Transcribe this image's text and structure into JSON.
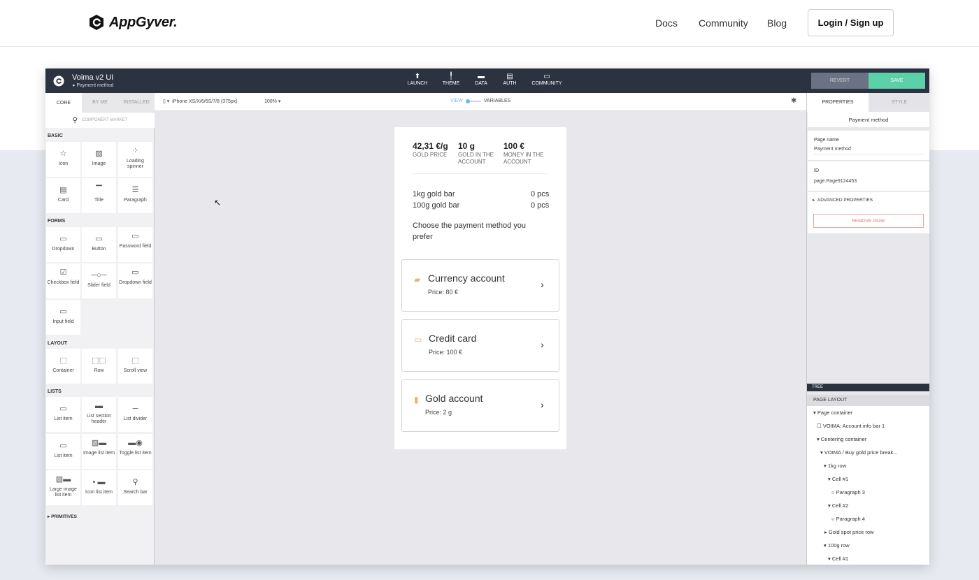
{
  "site": {
    "brand": "AppGyver.",
    "nav": [
      "Docs",
      "Community",
      "Blog"
    ],
    "login": "Login / Sign up"
  },
  "app": {
    "project_name": "Voima v2 UI",
    "page_name": "Payment method",
    "topnav": [
      {
        "label": "LAUNCH",
        "icon": "rocket-icon"
      },
      {
        "label": "THEME",
        "icon": "brush-icon"
      },
      {
        "label": "DATA",
        "icon": "folder-icon"
      },
      {
        "label": "AUTH",
        "icon": "document-icon"
      },
      {
        "label": "COMMUNITY",
        "icon": "chat-icon"
      }
    ],
    "revert": "REVERT",
    "save": "SAVE",
    "save_color": "#5cd0a8"
  },
  "left": {
    "tabs": [
      "CORE",
      "BY ME",
      "INSTALLED"
    ],
    "search_placeholder": "COMPONENT MARKET",
    "sections": {
      "basic": "BASIC",
      "forms": "FORMS",
      "layout": "LAYOUT",
      "lists": "LISTS",
      "primitives": "PRIMITIVES"
    },
    "components": {
      "icon": "Icon",
      "image": "Image",
      "spinner": "Loading spinner",
      "card": "Card",
      "title": "Title",
      "paragraph": "Paragraph",
      "dropdown": "Dropdown",
      "button": "Button",
      "password": "Password field",
      "checkbox": "Checkbox field",
      "slider": "Slider field",
      "dropdown_field": "Dropdown field",
      "input": "Input field",
      "container": "Container",
      "row": "Row",
      "scroll": "Scroll view",
      "list_item": "List item",
      "list_section": "List section header",
      "list_divider": "List divider",
      "list_item2": "List item",
      "image_list": "Image list item",
      "toggle_list": "Toggle list item",
      "large_image_list": "Large image list item",
      "icon_list": "Icon list item",
      "search_bar": "Search bar"
    }
  },
  "canvas": {
    "device": "iPhone XS/X/6/6S/7/8 (375px)",
    "zoom": "100%",
    "view": "VIEW",
    "variables": "VARIABLES",
    "stats": [
      {
        "value": "42,31 €/g",
        "label": "GOLD PRICE"
      },
      {
        "value": "10 g",
        "label": "GOLD IN THE ACCOUNT"
      },
      {
        "value": "100 €",
        "label": "MONEY IN THE ACCOUNT"
      }
    ],
    "rows": [
      {
        "name": "1kg gold bar",
        "qty": "0 pcs"
      },
      {
        "name": "100g gold bar",
        "qty": "0 pcs"
      }
    ],
    "prompt": "Choose the payment method you prefer",
    "methods": [
      {
        "title": "Currency account",
        "price": "Price: 80 €",
        "icon": "briefcase-icon"
      },
      {
        "title": "Credit card",
        "price": "Price: 100 €",
        "icon": "credit-card-icon"
      },
      {
        "title": "Gold account",
        "price": "Price: 2 g",
        "icon": "bookmark-icon"
      }
    ],
    "accent_color": "#e0b877"
  },
  "right": {
    "tabs": [
      "PROPERTIES",
      "STYLE"
    ],
    "title": "Payment method",
    "page_name_label": "Page name",
    "page_name_value": "Payment method",
    "id_label": "ID",
    "id_value": "page.Page9124453",
    "advanced": "ADVANCED PROPERTIES",
    "remove": "REMOVE PAGE",
    "tree_label": "TREE",
    "page_layout": "PAGE LAYOUT",
    "tree": [
      "Page container",
      "VOIMA: Account info bar 1",
      "Centering container",
      "VOIMA / Buy gold price break...",
      "1kg row",
      "Cell #1",
      "Paragraph 3",
      "Cell #2",
      "Paragraph 4",
      "Gold spot price row",
      "100g row",
      "Cell #1"
    ]
  }
}
